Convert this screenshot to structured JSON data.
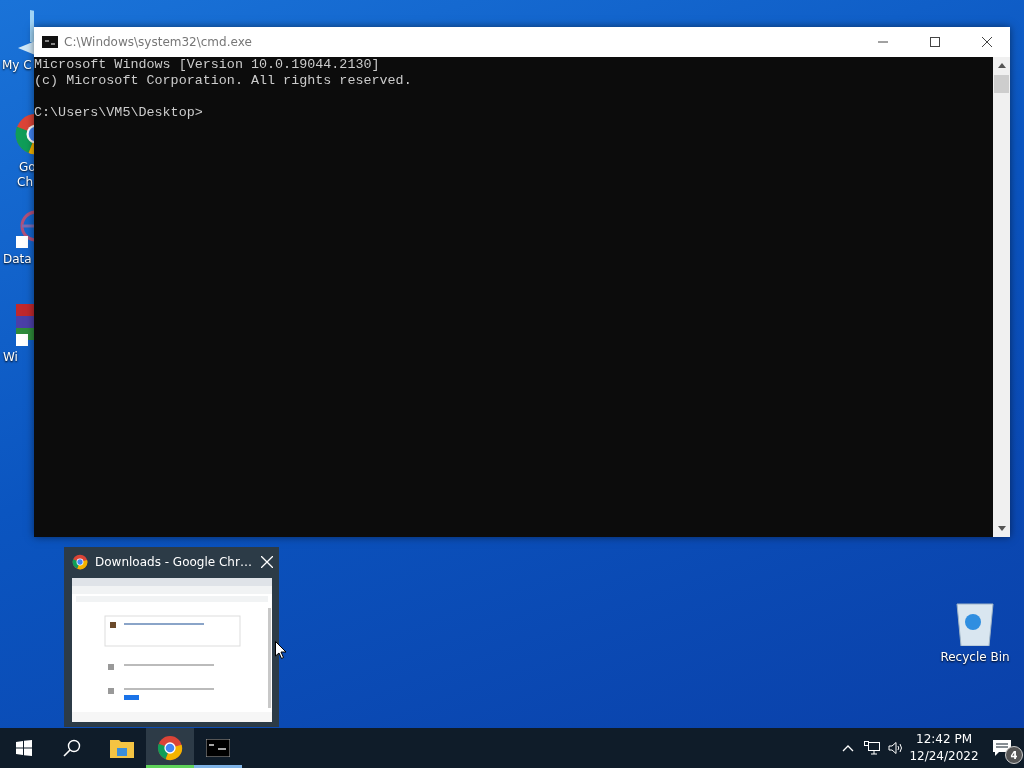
{
  "desktop_icons": [
    {
      "kind": "computer",
      "lines": [
        "My C"
      ]
    },
    {
      "kind": "chrome",
      "lines": [
        "Go",
        "Ch"
      ]
    },
    {
      "kind": "dataw",
      "lines": [
        "Data"
      ]
    },
    {
      "kind": "winrar",
      "lines": [
        "Wi"
      ]
    }
  ],
  "recycle_bin": {
    "label": "Recycle Bin"
  },
  "window": {
    "title": "C:\\Windows\\system32\\cmd.exe",
    "console_blocks": [
      [
        "Microsoft Windows [Version 10.0.19044.2130]",
        "(c) Microsoft Corporation. All rights reserved."
      ],
      [
        "C:\\Users\\VM5\\Desktop>"
      ]
    ]
  },
  "taskbar_preview": {
    "title": "Downloads - Google Chr…"
  },
  "taskbar": {
    "apps": [
      {
        "kind": "explorer",
        "running": false,
        "selected": false
      },
      {
        "kind": "chrome",
        "running": true,
        "selected": true
      },
      {
        "kind": "cmd",
        "running": true,
        "selected": false
      }
    ],
    "time": "12:42 PM",
    "date": "12/24/2022",
    "notification_count": "4"
  }
}
